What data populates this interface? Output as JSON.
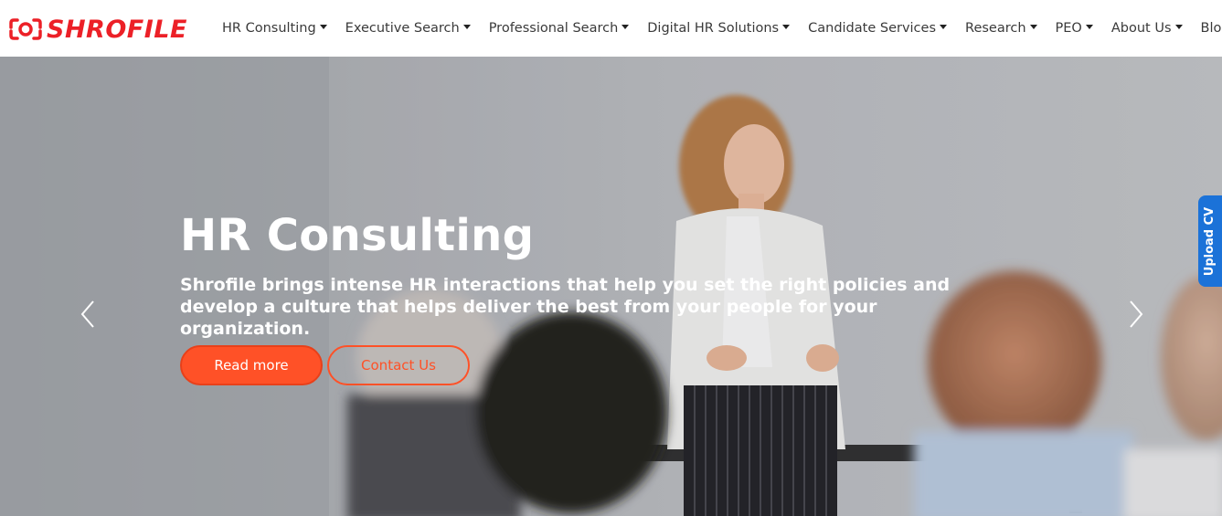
{
  "brand": {
    "name": "SHROFILE",
    "color": "#ec2027"
  },
  "nav": {
    "items": [
      {
        "label": "HR Consulting",
        "dropdown": true
      },
      {
        "label": "Executive Search",
        "dropdown": true
      },
      {
        "label": "Professional Search",
        "dropdown": true
      },
      {
        "label": "Digital HR Solutions",
        "dropdown": true
      },
      {
        "label": "Candidate Services",
        "dropdown": true
      },
      {
        "label": "Research",
        "dropdown": true
      },
      {
        "label": "PEO",
        "dropdown": true
      },
      {
        "label": "About Us",
        "dropdown": true
      },
      {
        "label": "Blog",
        "dropdown": false
      }
    ]
  },
  "hero": {
    "title": "HR Consulting",
    "text": "Shrofile brings intense HR interactions that help you set the right policies and develop a culture that helps deliver the best from your people for your organization.",
    "primary_button": "Read more",
    "secondary_button": "Contact Us",
    "prev_icon": "chevron-left-icon",
    "next_icon": "chevron-right-icon",
    "accent_color": "#ff5127"
  },
  "side_tab": {
    "label": "Upload CV",
    "color": "#1b72d8"
  }
}
